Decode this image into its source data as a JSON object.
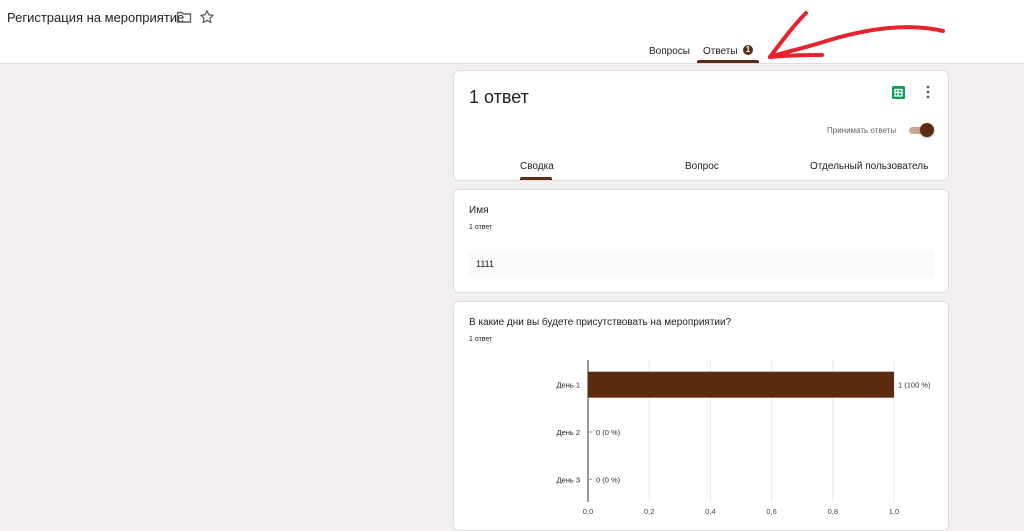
{
  "header": {
    "doc_title": "Регистрация на мероприятие",
    "tabs": [
      {
        "label": "Вопросы"
      },
      {
        "label": "Ответы",
        "badge": "1"
      }
    ]
  },
  "summary": {
    "response_count": "1 ответ",
    "accepting_label": "Принимать ответы",
    "accepting_enabled": true,
    "sub_tabs": [
      {
        "label": "Сводка"
      },
      {
        "label": "Вопрос"
      },
      {
        "label": "Отдельный пользователь"
      }
    ]
  },
  "questions": [
    {
      "title": "Имя",
      "count": "1 ответ",
      "answers": [
        "1111"
      ]
    },
    {
      "title": "В какие дни вы будете присутствовать на мероприятии?",
      "count": "1 ответ"
    }
  ],
  "colors": {
    "accent": "#5b2c0f",
    "annotation_arrow": "#e8212a",
    "sheets_icon": "#0f9d58"
  },
  "chart_data": {
    "type": "bar",
    "orientation": "horizontal",
    "categories": [
      "День 1",
      "День 2",
      "День 3"
    ],
    "values": [
      1,
      0,
      0
    ],
    "data_labels": [
      "1 (100 %)",
      "0 (0 %)",
      "0 (0 %)"
    ],
    "xlim": [
      0,
      1
    ],
    "x_ticks": [
      "0,0",
      "0,2",
      "0,4",
      "0,6",
      "0,8",
      "1,0"
    ],
    "grid": true,
    "color": "#5b2c0f"
  }
}
